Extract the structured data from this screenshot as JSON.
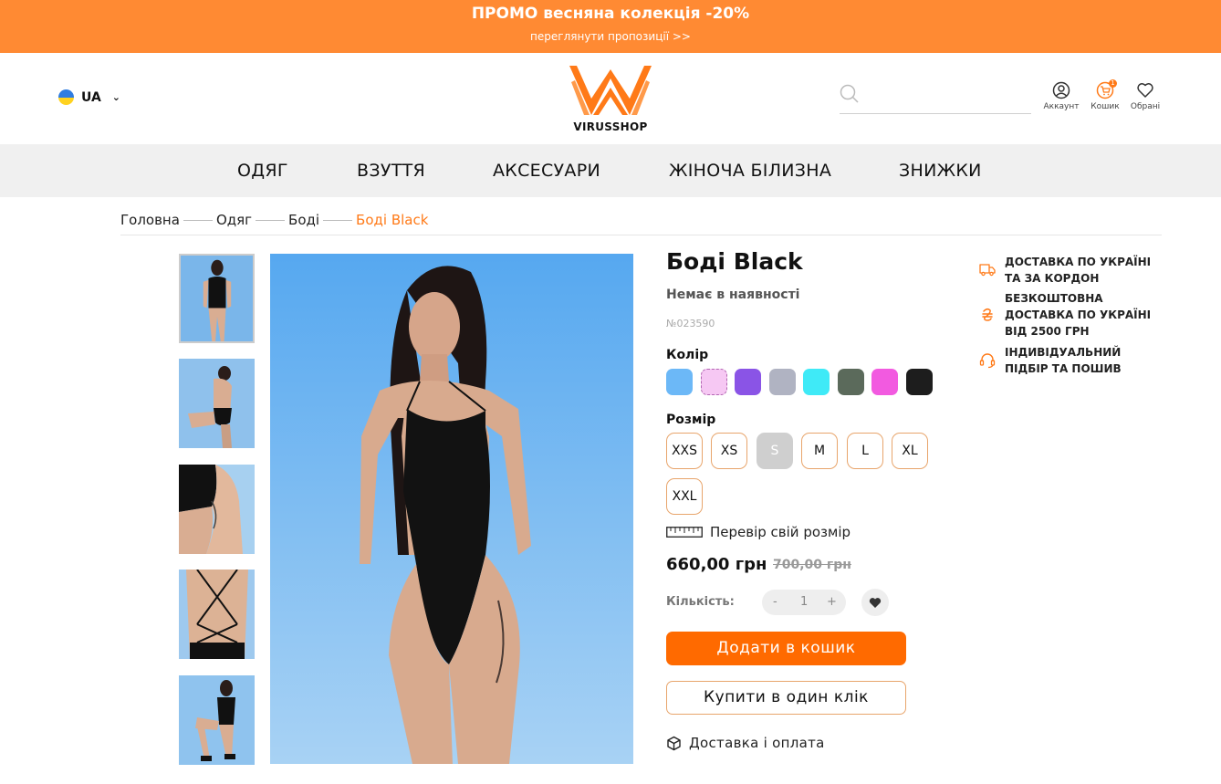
{
  "promo": {
    "title": "ПРОМО весняна колекція -20%",
    "link": "переглянути пропозиції >>"
  },
  "header": {
    "language": "UA",
    "logo_text": "VIRUSSHOP",
    "search": {
      "placeholder": "",
      "value": ""
    },
    "icons": [
      {
        "name": "account",
        "label": "Аккаунт"
      },
      {
        "name": "cart",
        "label": "Кошик",
        "count": "1"
      },
      {
        "name": "favorites",
        "label": "Обрані"
      }
    ]
  },
  "nav": {
    "items": [
      "ОДЯГ",
      "ВЗУТТЯ",
      "АКСЕСУАРИ",
      "ЖІНОЧА БІЛИЗНА",
      "ЗНИЖКИ"
    ]
  },
  "breadcrumb": {
    "items": [
      "Головна",
      "Одяг",
      "Боді"
    ],
    "current": "Боді Black"
  },
  "product": {
    "title": "Боді Black",
    "availability": "Немає в наявності",
    "sku": "№023590",
    "color_label": "Колір",
    "colors": [
      {
        "hex": "#6cb8f7",
        "selected": false
      },
      {
        "hex": "#f6c8f3",
        "selected": true
      },
      {
        "hex": "#8a54e6",
        "selected": false
      },
      {
        "hex": "#b0b3c2",
        "selected": false
      },
      {
        "hex": "#3feaf7",
        "selected": false
      },
      {
        "hex": "#5b6a5b",
        "selected": false
      },
      {
        "hex": "#f25ae0",
        "selected": false
      },
      {
        "hex": "#1d1d1d",
        "selected": false
      }
    ],
    "size_label": "Розмір",
    "sizes": [
      {
        "label": "XXS",
        "available": true
      },
      {
        "label": "XS",
        "available": true
      },
      {
        "label": "S",
        "available": false
      },
      {
        "label": "M",
        "available": true
      },
      {
        "label": "L",
        "available": true
      },
      {
        "label": "XL",
        "available": true
      },
      {
        "label": "XXL",
        "available": true
      }
    ],
    "size_guide": "Перевір свій розмір",
    "price": "660,00 грн",
    "old_price": "700,00 грн",
    "quantity_label": "Кількість:",
    "quantity": "1",
    "qty_minus": "-",
    "qty_plus": "+",
    "add_to_cart": "Додати в кошик",
    "buy_one_click": "Купити в один клік",
    "delivery_link": "Доставка і оплата"
  },
  "benefits": [
    {
      "icon": "truck-icon",
      "lines": [
        "ДОСТАВКА ПО УКРАЇНІ",
        "ТА ЗА КОРДОН"
      ]
    },
    {
      "icon": "hryvnia-icon",
      "lines": [
        "БЕЗКОШТОВНА",
        "ДОСТАВКА ПО УКРАЇНІ",
        "ВІД 2500 ГРН"
      ]
    },
    {
      "icon": "headset-icon",
      "lines": [
        "ІНДИВІДУАЛЬНИЙ",
        "ПІДБІР ТА ПОШИВ"
      ]
    }
  ],
  "colors": {
    "accent": "#ff7a18",
    "promo_bg": "#ff8a33",
    "nav_bg": "#f0f0f0"
  }
}
